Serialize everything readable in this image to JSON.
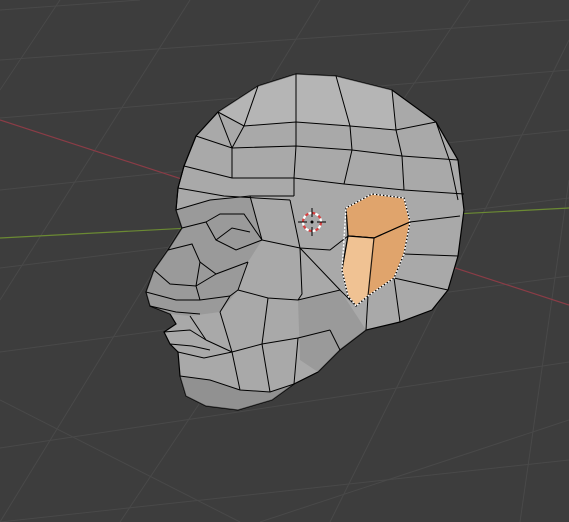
{
  "viewport": {
    "mode": "edit",
    "background_color": "#3d3d3d",
    "grid_line_color": "#494949",
    "x_axis_color": "#8a3c46",
    "y_axis_color": "#6b8a33"
  },
  "mesh": {
    "object": "head",
    "base_color": "#a9a9a9",
    "shadow_color": "#7e7e7e",
    "highlight_color": "#c4c4c4",
    "wire_color": "#000000",
    "selection": {
      "region": "ear",
      "face_color": "#e0a46c",
      "highlight_color": "#f3c89a",
      "edge_color": "#ffffff"
    }
  },
  "cursor": {
    "icon": "3d-cursor-icon",
    "ring_colors": [
      "#d84040",
      "#ffffff"
    ]
  }
}
